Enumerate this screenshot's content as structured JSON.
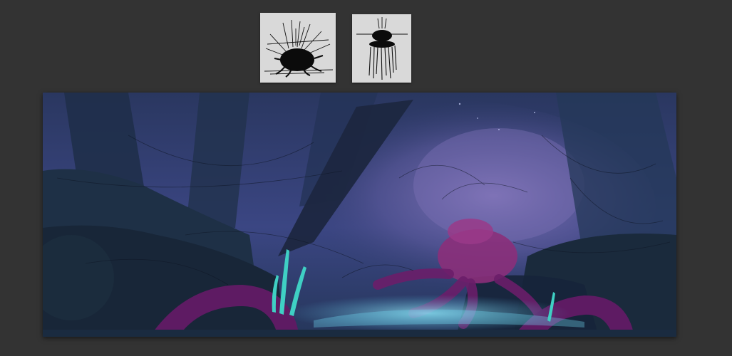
{
  "thumbnails": [
    {
      "id": "thumb-1",
      "subject": "spiky-creature-sketch"
    },
    {
      "id": "thumb-2",
      "subject": "floating-jellyfish-sketch"
    }
  ],
  "main_artwork": {
    "subject": "underwater-alien-forest-concept-painting",
    "colors": {
      "sky_top": "#2a3760",
      "mist": "#6a64a6",
      "foliage_dark": "#1b2838",
      "creature": "#8b2f7a",
      "tentacle": "#6b1e6a",
      "glow": "#4fe0d6"
    }
  }
}
